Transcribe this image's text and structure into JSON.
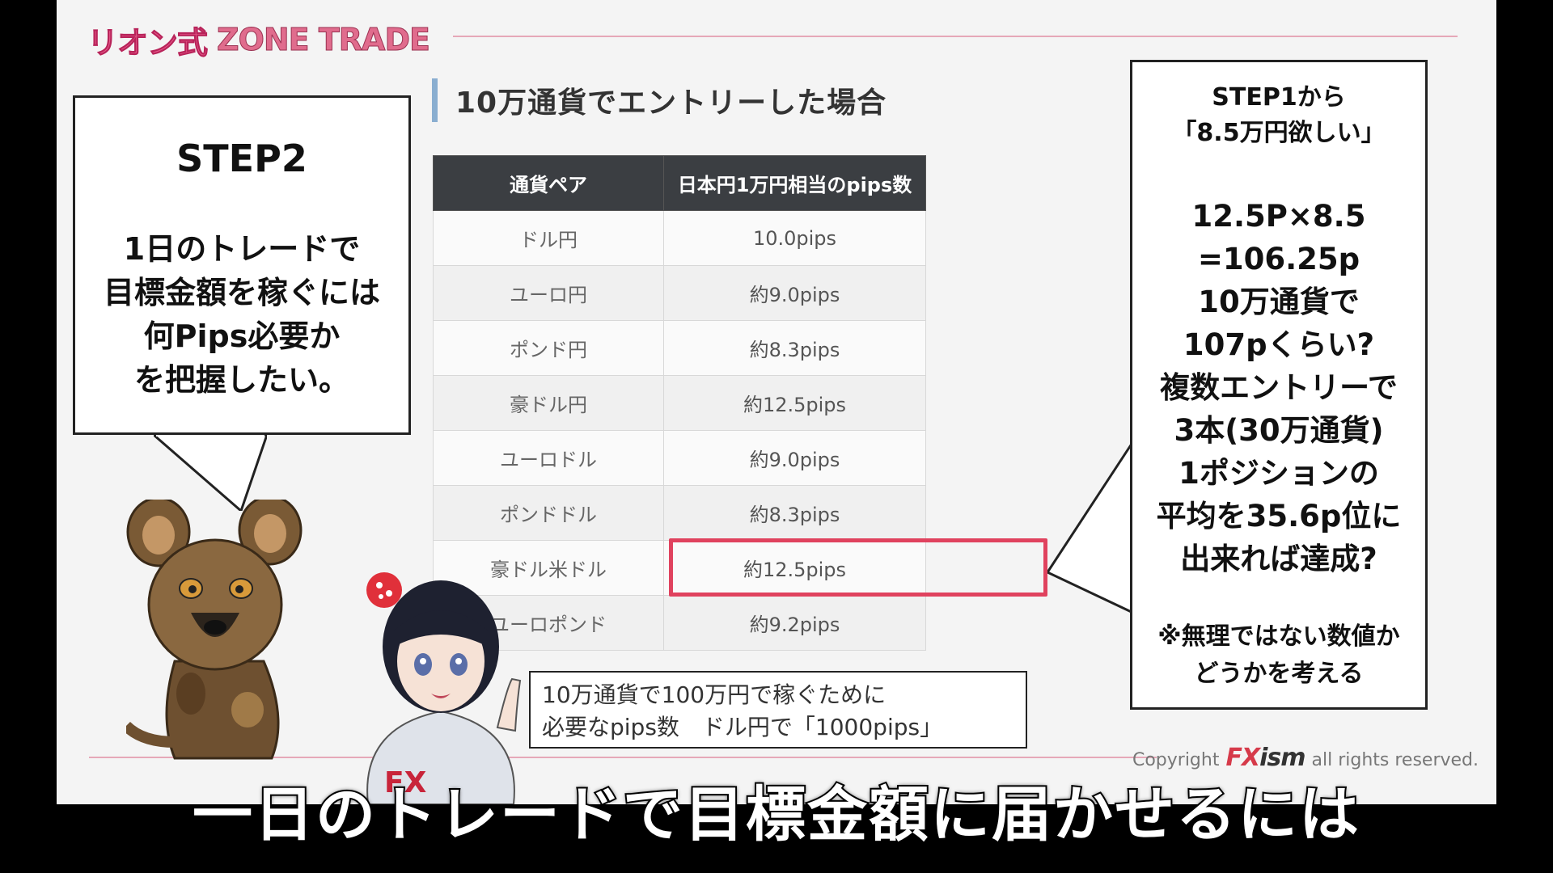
{
  "header": {
    "logo_brand": "リオン式",
    "logo_name": "ZONE TRADE"
  },
  "section_title": "10万通貨でエントリーした場合",
  "table": {
    "headers": [
      "通貨ペア",
      "日本円1万円相当のpips数"
    ],
    "rows": [
      [
        "ドル円",
        "10.0pips"
      ],
      [
        "ユーロ円",
        "約9.0pips"
      ],
      [
        "ポンド円",
        "約8.3pips"
      ],
      [
        "豪ドル円",
        "約12.5pips"
      ],
      [
        "ユーロドル",
        "約9.0pips"
      ],
      [
        "ポンドドル",
        "約8.3pips"
      ],
      [
        "豪ドル米ドル",
        "約12.5pips"
      ],
      [
        "ユーロポンド",
        "約9.2pips"
      ]
    ]
  },
  "step2_bubble": {
    "title": "STEP2",
    "body": "1日のトレードで\n目標金額を稼ぐには\n何Pips必要か\nを把握したい。"
  },
  "step1_bubble": {
    "heading": "STEP1から\n「8.5万円欲しい」",
    "calculation": "12.5P×8.5\n=106.25p\n10万通貨で\n107pくらい?\n複数エントリーで\n3本(30万通貨)\n1ポジションの\n平均を35.6p位に\n出来れば達成?",
    "note": "※無理ではない数値か\nどうかを考える"
  },
  "note_box": "10万通貨で100万円で稼ぐために\n必要なpips数　ドル円で「1000pips」",
  "copyright": {
    "prefix": "Copyright",
    "logo_fx": "FX",
    "logo_ism": "ism",
    "suffix": "all rights reserved."
  },
  "subtitle": "一日のトレードで目標金額に届かせるには",
  "colors": {
    "highlight": "#e0425e",
    "table_header": "#3b3e42",
    "brand_pink": "#e8588a"
  }
}
